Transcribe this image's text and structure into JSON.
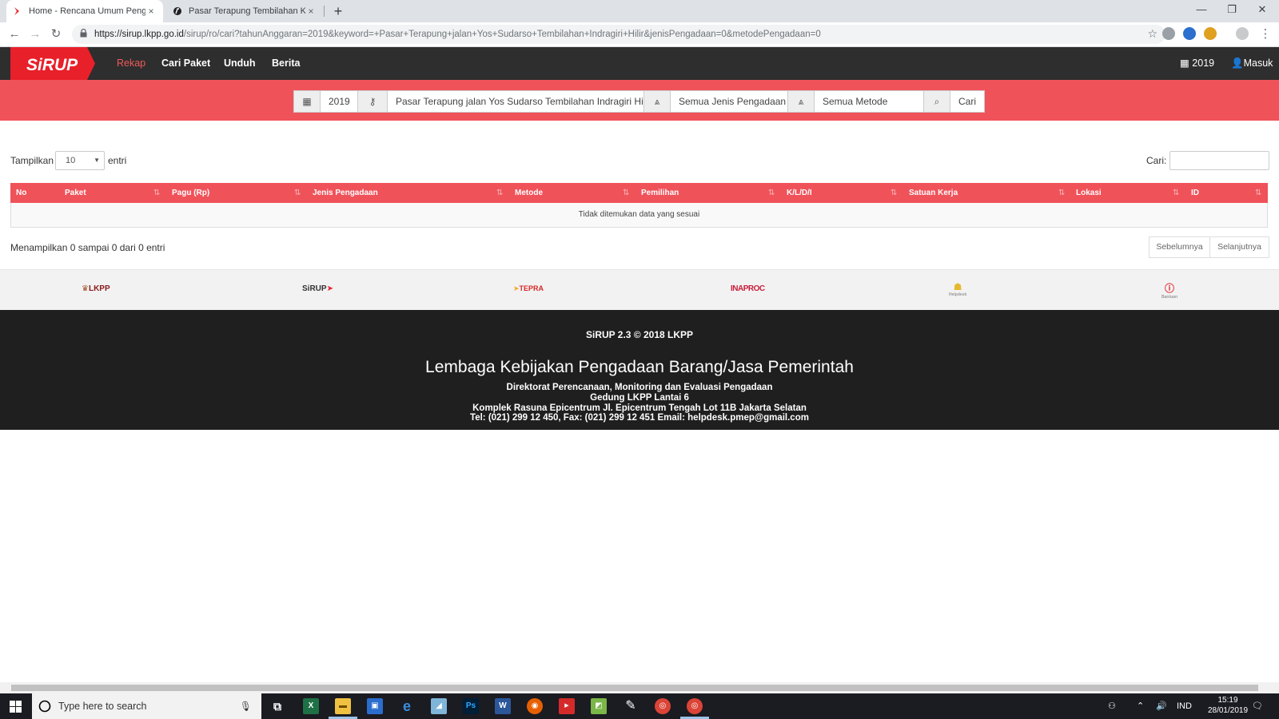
{
  "browser": {
    "tabs": [
      {
        "title": "Home - Rencana Umum Pengadaan",
        "close": "×"
      },
      {
        "title": "Pasar Terapung Tembilahan Kemiri",
        "close": "×"
      }
    ],
    "new_tab": "+",
    "window_controls": [
      "—",
      "❐",
      "✕"
    ],
    "url_host": "https://sirup.lkpp.go.id",
    "url_rest": "/sirup/ro/cari?tahunAnggaran=2019&keyword=+Pasar+Terapung+jalan+Yos+Sudarso+Tembilahan+Indragiri+Hilir&jenisPengadaan=0&metodePengadaan=0"
  },
  "nav": {
    "logo": "SiRUP",
    "links": [
      "Rekap",
      "Cari Paket",
      "Unduh",
      "Berita"
    ],
    "year": "2019",
    "login": "Masuk"
  },
  "search": {
    "year": "2019",
    "keyword": "Pasar Terapung jalan Yos Sudarso Tembilahan Indragiri Hilir",
    "jenis": "Semua Jenis Pengadaan",
    "metode": "Semua Metode",
    "button": "Cari"
  },
  "table": {
    "show_label": "Tampilkan",
    "page_size": "10",
    "entries_label": "entri",
    "search_label": "Cari:",
    "columns": [
      "No",
      "Paket",
      "Pagu (Rp)",
      "Jenis Pengadaan",
      "Metode",
      "Pemilihan",
      "K/L/D/I",
      "Satuan Kerja",
      "Lokasi",
      "ID"
    ],
    "empty_message": "Tidak ditemukan data yang sesuai",
    "info": "Menampilkan 0 sampai 0 dari 0 entri",
    "prev": "Sebelumnya",
    "next": "Selanjutnya"
  },
  "partners": [
    "LKPP",
    "SiRUP",
    "TEPRA",
    "INAPROC",
    "Helpdesk",
    "Bantuan"
  ],
  "footer": {
    "copyright": "SiRUP 2.3 © 2018 LKPP",
    "title": "Lembaga Kebijakan Pengadaan Barang/Jasa Pemerintah",
    "lines": [
      "Direktorat Perencanaan, Monitoring dan Evaluasi Pengadaan",
      "Gedung LKPP Lantai 6",
      "Komplek Rasuna Epicentrum Jl. Epicentrum Tengah Lot 11B Jakarta Selatan",
      "Tel: (021) 299 12 450, Fax: (021) 299 12 451 Email: helpdesk.pmep@gmail.com"
    ]
  },
  "taskbar": {
    "search_placeholder": "Type here to search",
    "lang": "IND",
    "time": "15:19",
    "date": "28/01/2019"
  },
  "colors": {
    "brand_red": "#f0525a",
    "nav_dark": "#2e2e2e",
    "footer_dark": "#1f1f1f"
  }
}
